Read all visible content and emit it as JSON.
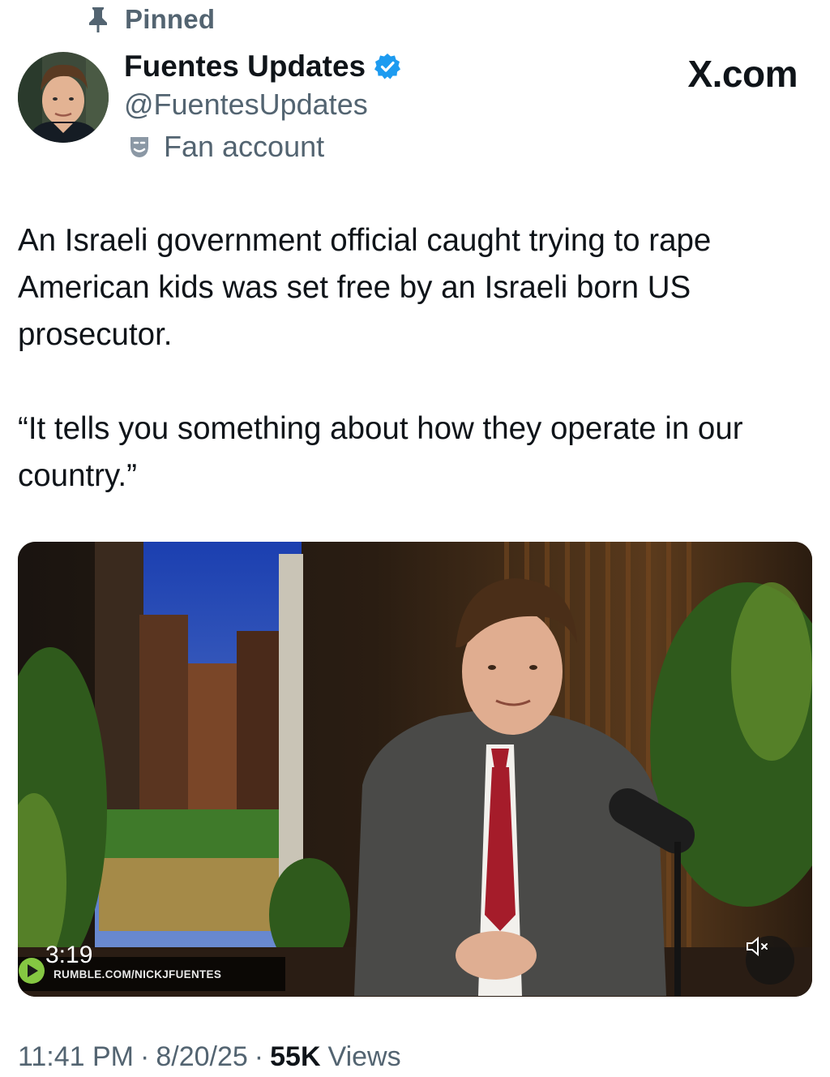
{
  "pinned": {
    "label": "Pinned",
    "icon": "pin-icon"
  },
  "author": {
    "display_name": "Fuentes Updates",
    "handle": "@FuentesUpdates",
    "verified": true,
    "verified_color": "#1d9bf0",
    "account_label": "Fan account",
    "account_label_icon": "theater-masks-icon"
  },
  "brand": "X.com",
  "post": {
    "paragraph_1": "An Israeli government official caught trying to rape American kids was set free by an Israeli born US prosecutor.",
    "paragraph_2": "“It tells you something about how they operate in our country.”"
  },
  "video": {
    "duration": "3:19",
    "source": "RUMBLE.COM/NICKJFUENTES",
    "muted": true
  },
  "meta": {
    "time": "11:41 PM",
    "separator": "·",
    "date": "8/20/25",
    "views_count": "55K",
    "views_label": "Views"
  },
  "colors": {
    "text_primary": "#0f1419",
    "text_secondary": "#536471",
    "accent": "#1d9bf0",
    "rumble_green": "#85c742"
  }
}
